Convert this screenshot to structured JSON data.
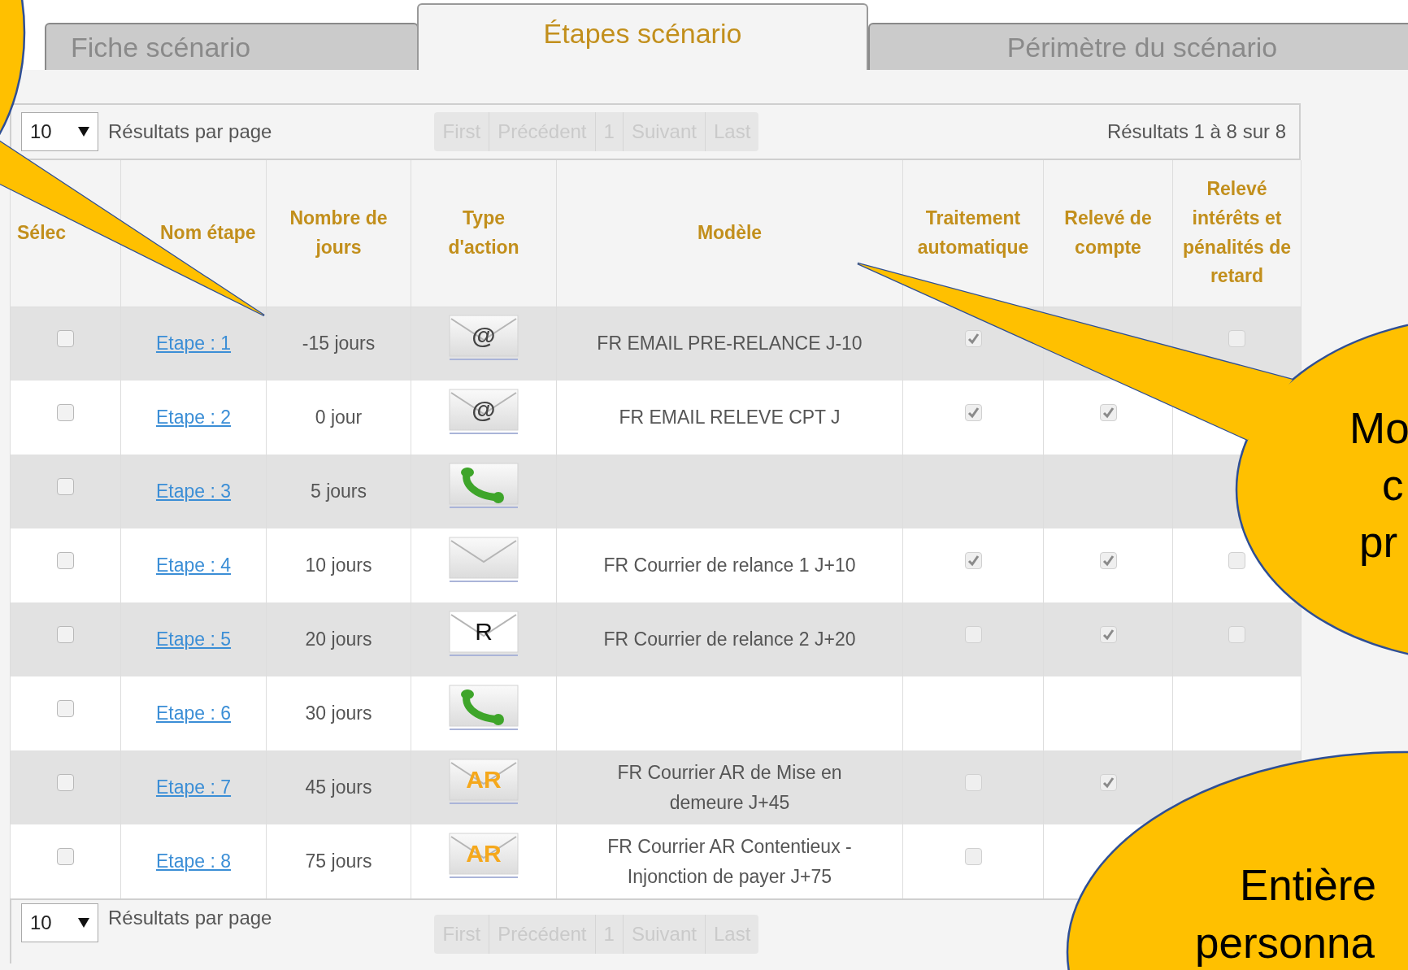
{
  "tabs": [
    {
      "label": "Fiche scénario",
      "selected": false
    },
    {
      "label": "Étapes scénario",
      "selected": true
    },
    {
      "label": "Périmètre du scénario",
      "selected": false
    }
  ],
  "top_toolbar": {
    "page_size": "10",
    "page_size_label": "Résultats par page",
    "results": "Résultats 1 à 8 sur 8",
    "pager": [
      {
        "label": "First",
        "disabled": true
      },
      {
        "label": "Précédent",
        "disabled": true
      },
      {
        "label": "1",
        "disabled": true
      },
      {
        "label": "Suivant",
        "disabled": true
      },
      {
        "label": "Last",
        "disabled": true
      }
    ]
  },
  "table": {
    "columns": [
      "Sélec",
      "Nom étape",
      "Nombre de jours",
      "Type d'action",
      "Modèle",
      "Traitement automatique",
      "Relevé de compte",
      "Relevé intérêts et pénalités de retard"
    ],
    "rows": [
      {
        "checked": false,
        "name": "Etape : 1",
        "days": "-15 jours",
        "action": {
          "kind": "email",
          "glyph": "@"
        },
        "model": "FR EMAIL PRE-RELANCE J-10",
        "auto": true,
        "interets": false
      },
      {
        "checked": false,
        "name": "Etape : 2",
        "days": "0 jour",
        "action": {
          "kind": "email",
          "glyph": "@"
        },
        "model": "FR EMAIL RELEVE CPT J",
        "auto": true,
        "releve": true
      },
      {
        "checked": false,
        "name": "Etape : 3",
        "days": "5 jours",
        "action": {
          "kind": "phone"
        }
      },
      {
        "checked": false,
        "name": "Etape : 4",
        "days": "10 jours",
        "action": {
          "kind": "letter"
        },
        "model": "FR Courrier de relance 1 J+10",
        "auto": true,
        "releve": true,
        "interets": false
      },
      {
        "checked": false,
        "name": "Etape : 5",
        "days": "20 jours",
        "action": {
          "kind": "registered",
          "glyph": "R"
        },
        "model": "FR Courrier de relance 2 J+20",
        "auto": false,
        "releve": true,
        "interets": false
      },
      {
        "checked": false,
        "name": "Etape : 6",
        "days": "30 jours",
        "action": {
          "kind": "phone"
        }
      },
      {
        "checked": false,
        "name": "Etape : 7",
        "days": "45 jours",
        "action": {
          "kind": "ar",
          "glyph": "AR"
        },
        "model": "FR Courrier AR de Mise en demeure J+45",
        "auto": false,
        "releve": true
      },
      {
        "checked": false,
        "name": "Etape : 8",
        "days": "75 jours",
        "action": {
          "kind": "ar",
          "glyph": "AR"
        },
        "model": "FR Courrier AR Contentieux - Injonction de payer J+75",
        "auto": false
      }
    ]
  },
  "bottom_toolbar": {
    "page_size": "10",
    "page_size_label": "Résultats par page",
    "pager": [
      {
        "label": "First",
        "disabled": true
      },
      {
        "label": "Précédent",
        "disabled": true
      },
      {
        "label": "1",
        "disabled": true
      },
      {
        "label": "Suivant",
        "disabled": true
      },
      {
        "label": "Last",
        "disabled": true
      }
    ]
  },
  "callouts": [
    {
      "kind": "top-left"
    },
    {
      "kind": "right",
      "lines": [
        "Mo",
        "c",
        "pr"
      ]
    },
    {
      "kind": "bottom-right",
      "lines": [
        "Entière",
        "personna"
      ]
    }
  ]
}
